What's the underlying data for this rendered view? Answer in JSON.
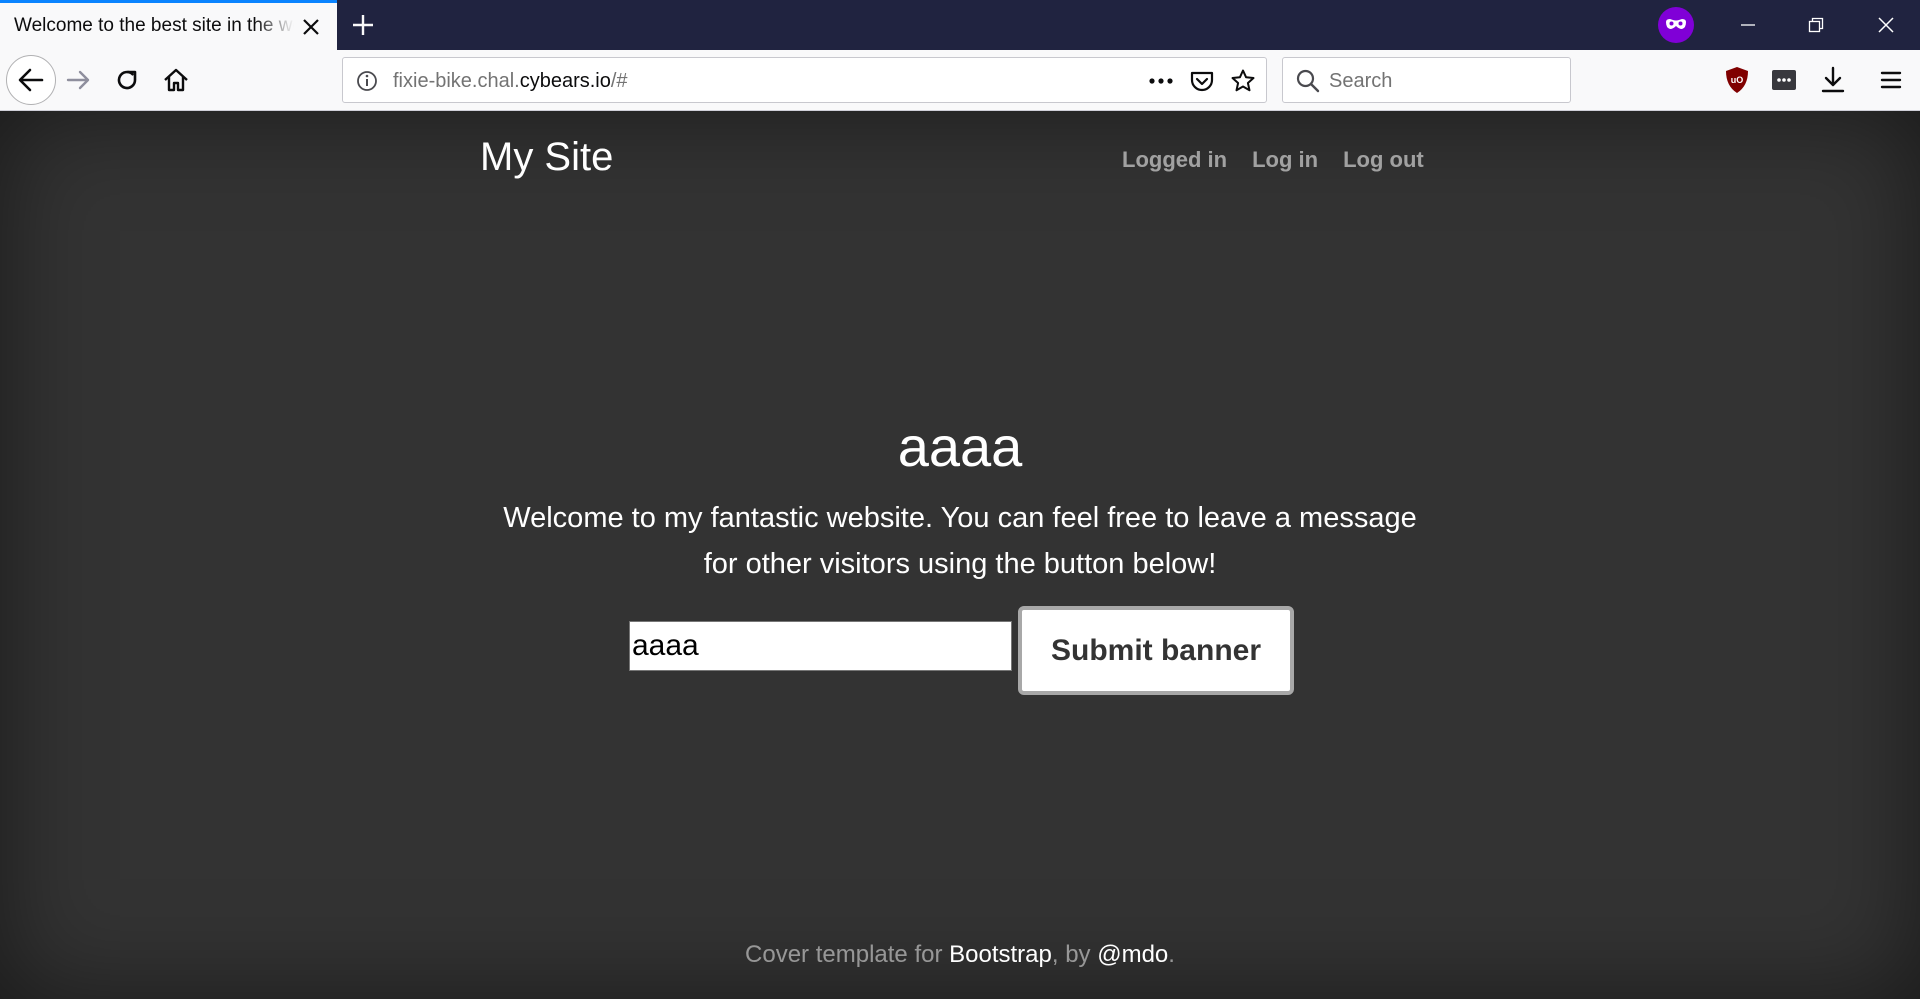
{
  "browser": {
    "tab_title": "Welcome to the best site in the world",
    "url_path_prefix": "fixie-bike.chal.",
    "url_host": "cybears.io",
    "url_suffix": "/#",
    "search_placeholder": "Search",
    "colors": {
      "tabbar": "#202340",
      "active_tab_accent": "#0a84ff",
      "private_badge": "#8000d7"
    },
    "icons": [
      "close-icon",
      "plus-icon",
      "private-browsing-icon",
      "minimize-icon",
      "restore-icon",
      "window-close-icon",
      "back-icon",
      "forward-icon",
      "reload-icon",
      "home-icon",
      "info-icon",
      "more-icon",
      "pocket-icon",
      "star-icon",
      "search-icon",
      "ublock-icon",
      "extension-icon",
      "download-icon",
      "menu-icon"
    ]
  },
  "site": {
    "brand": "My Site",
    "nav": [
      "Logged in",
      "Log in",
      "Log out"
    ],
    "headline": "aaaa",
    "lead": "Welcome to my fantastic website. You can feel free to leave a message for other visitors using the button below!",
    "input_value": "aaaa",
    "submit_label": "Submit banner",
    "footer": {
      "prefix": "Cover template for ",
      "link1": "Bootstrap",
      "middle": ", by ",
      "link2": "@mdo",
      "suffix": "."
    },
    "colors": {
      "background": "#333333",
      "text": "#ffffff"
    }
  }
}
